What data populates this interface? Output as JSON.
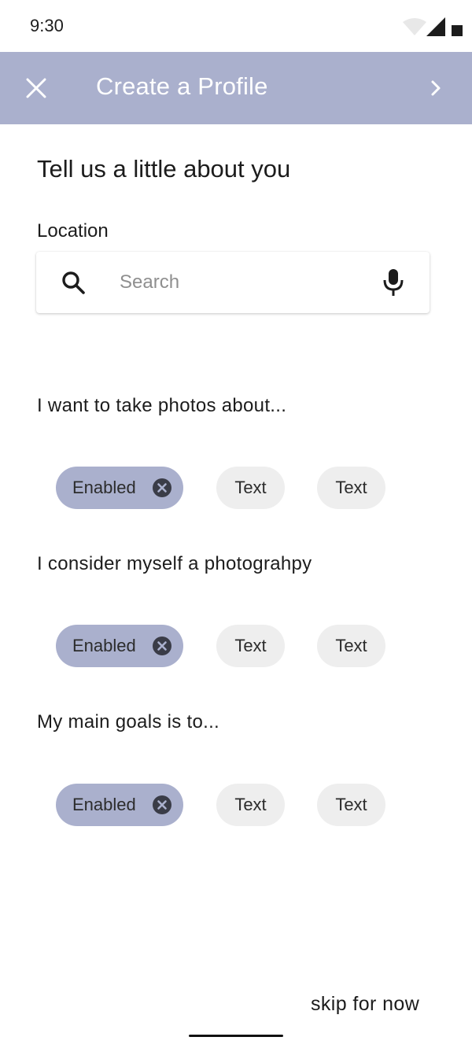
{
  "status_bar": {
    "time": "9:30",
    "icons": [
      "wifi-icon",
      "cellular-signal-icon",
      "battery-icon"
    ]
  },
  "app_bar": {
    "title": "Create a Profile",
    "close_icon": "close-icon",
    "next_icon": "chevron-right-icon",
    "background_color": "#aab0cd"
  },
  "content": {
    "heading": "Tell us a little about you",
    "location": {
      "label": "Location",
      "search_placeholder": "Search",
      "search_value": "",
      "search_icon": "search-icon",
      "mic_icon": "microphone-icon"
    },
    "sections": [
      {
        "question": "I want to take photos about...",
        "chips": [
          {
            "label": "Enabled",
            "selected": true
          },
          {
            "label": "Text",
            "selected": false
          },
          {
            "label": "Text",
            "selected": false
          }
        ]
      },
      {
        "question": "I consider myself a photograhpy",
        "chips": [
          {
            "label": "Enabled",
            "selected": true
          },
          {
            "label": "Text",
            "selected": false
          },
          {
            "label": "Text",
            "selected": false
          }
        ]
      },
      {
        "question": "My main goals is to...",
        "chips": [
          {
            "label": "Enabled",
            "selected": true
          },
          {
            "label": "Text",
            "selected": false
          },
          {
            "label": "Text",
            "selected": false
          }
        ]
      }
    ]
  },
  "footer": {
    "skip_label": "skip for now"
  },
  "colors": {
    "accent": "#aab0cd",
    "chip_unselected": "#eeeeee",
    "text": "#1c1c1c"
  }
}
